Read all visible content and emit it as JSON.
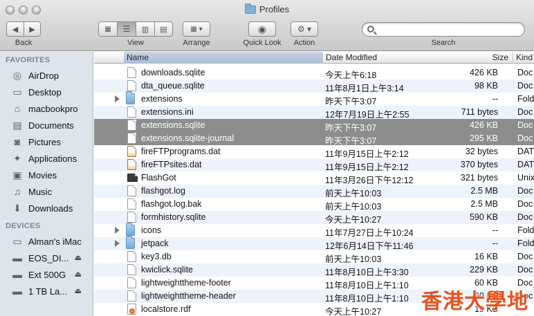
{
  "window": {
    "title": "Profiles"
  },
  "toolbar": {
    "back_label": "Back",
    "view_label": "View",
    "arrange_label": "Arrange",
    "quicklook_label": "Quick Look",
    "action_label": "Action",
    "search_label": "Search",
    "search_value": ""
  },
  "sidebar": {
    "favorites_header": "FAVORITES",
    "favorites": [
      {
        "label": "AirDrop",
        "icon": "airdrop-icon"
      },
      {
        "label": "Desktop",
        "icon": "desktop-icon"
      },
      {
        "label": "macbookpro",
        "icon": "home-icon"
      },
      {
        "label": "Documents",
        "icon": "documents-icon"
      },
      {
        "label": "Pictures",
        "icon": "pictures-icon"
      },
      {
        "label": "Applications",
        "icon": "applications-icon"
      },
      {
        "label": "Movies",
        "icon": "movies-icon"
      },
      {
        "label": "Music",
        "icon": "music-icon"
      },
      {
        "label": "Downloads",
        "icon": "downloads-icon"
      }
    ],
    "devices_header": "DEVICES",
    "devices": [
      {
        "label": "Alman's iMac",
        "icon": "imac-icon",
        "eject": false
      },
      {
        "label": "EOS_DI...",
        "icon": "disk-icon",
        "eject": true
      },
      {
        "label": "Ext 500G",
        "icon": "disk-icon",
        "eject": true
      },
      {
        "label": "1 TB La...",
        "icon": "disk-icon",
        "eject": true
      }
    ]
  },
  "columns": {
    "name": "Name",
    "date": "Date Modified",
    "size": "Size",
    "kind": "Kind"
  },
  "files": [
    {
      "name": "downloads.sqlite",
      "date": "今天上午6:18",
      "size": "426 KB",
      "kind": "Doc",
      "type": "doc"
    },
    {
      "name": "dta_queue.sqlite",
      "date": "11年8月1日上午3:14",
      "size": "98 KB",
      "kind": "Doc",
      "type": "doc"
    },
    {
      "name": "extensions",
      "date": "昨天下午3:07",
      "size": "--",
      "kind": "Fold",
      "type": "folder"
    },
    {
      "name": "extensions.ini",
      "date": "12年7月19日上午2:55",
      "size": "711 bytes",
      "kind": "Doc",
      "type": "doc"
    },
    {
      "name": "extensions.sqlite",
      "date": "昨天下午3:07",
      "size": "426 KB",
      "kind": "Doc",
      "type": "doc",
      "selected": true
    },
    {
      "name": "extensions.sqlite-journal",
      "date": "昨天下午3:07",
      "size": "295 KB",
      "kind": "Doc",
      "type": "doc",
      "selected": true
    },
    {
      "name": "fireFTPprograms.dat",
      "date": "11年9月15日上午2:12",
      "size": "32 bytes",
      "kind": "DAT",
      "type": "dat"
    },
    {
      "name": "fireFTPsites.dat",
      "date": "11年9月15日上午2:12",
      "size": "370 bytes",
      "kind": "DAT",
      "type": "dat"
    },
    {
      "name": "FlashGot",
      "date": "11年3月26日下午12:12",
      "size": "321 bytes",
      "kind": "Unix",
      "type": "exec"
    },
    {
      "name": "flashgot.log",
      "date": "前天上午10:03",
      "size": "2.5 MB",
      "kind": "Doc",
      "type": "doc"
    },
    {
      "name": "flashgot.log.bak",
      "date": "前天上午10:03",
      "size": "2.5 MB",
      "kind": "Doc",
      "type": "doc"
    },
    {
      "name": "formhistory.sqlite",
      "date": "今天上午10:27",
      "size": "590 KB",
      "kind": "Doc",
      "type": "doc"
    },
    {
      "name": "icons",
      "date": "11年7月27日上午10:24",
      "size": "--",
      "kind": "Fold",
      "type": "folder"
    },
    {
      "name": "jetpack",
      "date": "12年6月14日下午11:46",
      "size": "--",
      "kind": "Fold",
      "type": "folder"
    },
    {
      "name": "key3.db",
      "date": "前天上午10:03",
      "size": "16 KB",
      "kind": "Doc",
      "type": "doc"
    },
    {
      "name": "kwiclick.sqlite",
      "date": "11年8月10日上午3:30",
      "size": "229 KB",
      "kind": "Doc",
      "type": "doc"
    },
    {
      "name": "lightweighttheme-footer",
      "date": "11年8月10日上午1:10",
      "size": "60 KB",
      "kind": "Doc",
      "type": "doc"
    },
    {
      "name": "lightweighttheme-header",
      "date": "11年8月10日上午1:10",
      "size": "60 KB",
      "kind": "Doc",
      "type": "doc"
    },
    {
      "name": "localstore.rdf",
      "date": "今天上午10:27",
      "size": "19 KB",
      "kind": "",
      "type": "rdf"
    }
  ],
  "watermark": "香港大學地"
}
